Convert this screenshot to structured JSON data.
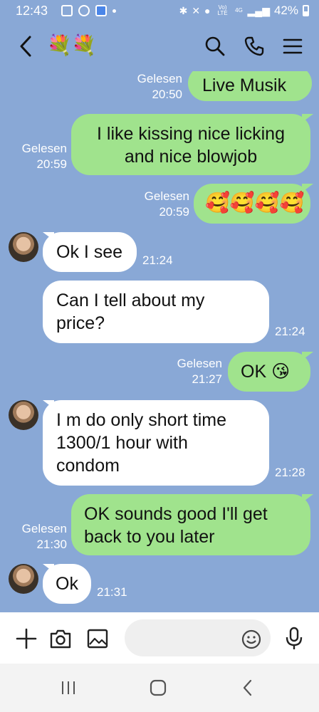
{
  "status_bar": {
    "time": "12:43",
    "network_label": "Vo) LTE",
    "network_gen": "4G",
    "battery": "42%"
  },
  "header": {
    "contact_name": "💐💐"
  },
  "messages": [
    {
      "side": "sent",
      "text": "Live Musik",
      "status": "Gelesen",
      "time": "20:50"
    },
    {
      "side": "sent",
      "text": "I like kissing nice licking and nice blowjob",
      "status": "Gelesen",
      "time": "20:59"
    },
    {
      "side": "sent",
      "text": "🥰🥰🥰🥰",
      "status": "Gelesen",
      "time": "20:59"
    },
    {
      "side": "recv",
      "text": "Ok I see",
      "time": "21:24"
    },
    {
      "side": "recv",
      "text": "Can I tell about my price?",
      "time": "21:24"
    },
    {
      "side": "sent",
      "text": "OK 😘",
      "status": "Gelesen",
      "time": "21:27"
    },
    {
      "side": "recv",
      "text": "I m do only short time 1300/1 hour with condom",
      "time": "21:28"
    },
    {
      "side": "sent",
      "text": "OK sounds good I'll get back to you later",
      "status": "Gelesen",
      "time": "21:30"
    },
    {
      "side": "recv",
      "text": "Ok",
      "time": "21:31"
    }
  ],
  "input": {
    "placeholder": "",
    "value": ""
  },
  "icons": {
    "back": "back-icon",
    "search": "search-icon",
    "call": "phone-icon",
    "menu": "menu-icon",
    "add": "plus-icon",
    "camera": "camera-icon",
    "gallery": "image-icon",
    "emoji": "emoji-icon",
    "mic": "mic-icon"
  },
  "colors": {
    "background": "#89a8d6",
    "sent_bubble": "#a0e38d",
    "received_bubble": "#ffffff"
  }
}
